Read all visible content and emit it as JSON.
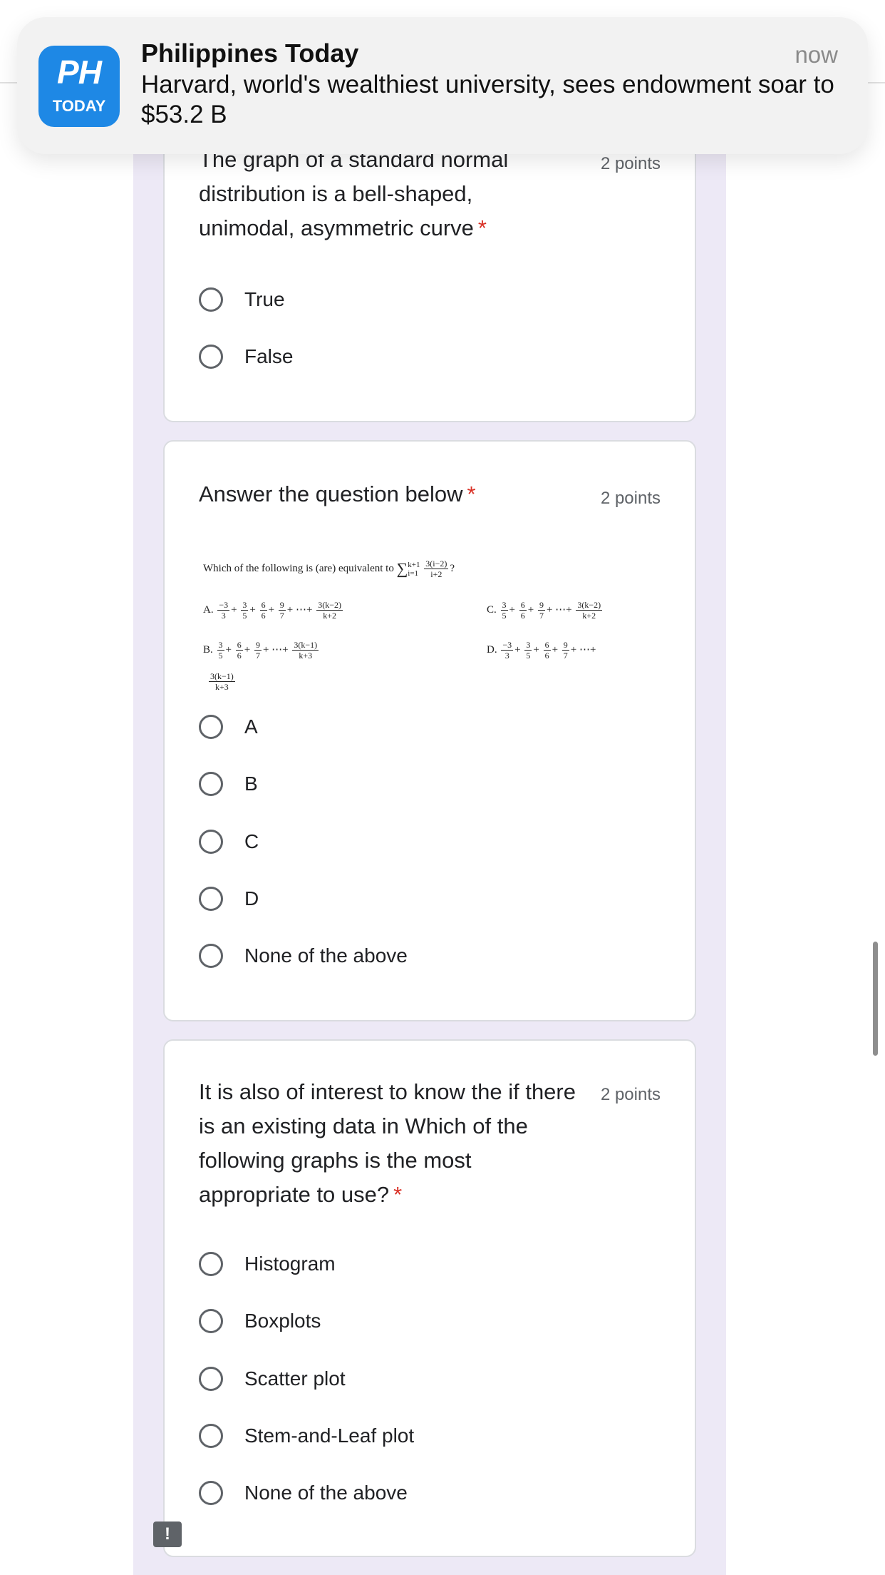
{
  "notification": {
    "app_icon_top": "PH",
    "app_icon_bottom": "TODAY",
    "app_name": "Philippines Today",
    "time": "now",
    "message": "Harvard, world's wealthiest university, sees endowment soar to $53.2 B"
  },
  "questions": [
    {
      "title": "The graph of a standard normal distribution is a bell-shaped, unimodal, asymmetric curve",
      "required_mark": "*",
      "points": "2 points",
      "options": [
        "True",
        "False"
      ]
    },
    {
      "title": "Answer the question below",
      "required_mark": "*",
      "points": "2 points",
      "image_text": {
        "stmt_prefix": "Which of the following is (are) equivalent to",
        "sum_upper": "k+1",
        "sum_lower": "i=1",
        "sum_num": "3(i−2)",
        "sum_den": "i+2",
        "qmark": "?",
        "a_label": "A.",
        "b_label": "B.",
        "c_label": "C.",
        "d_label": "D.",
        "n_m3": "−3",
        "n_3": "3",
        "n_6": "6",
        "n_9": "9",
        "d_3": "3",
        "d_5": "5",
        "d_6": "6",
        "d_7": "7",
        "plus": "+",
        "ellipsis": "⋯",
        "k_num_2": "3(k−2)",
        "k_den_2": "k+2",
        "k_num_1": "3(k−1)",
        "k_den_3": "k+3"
      },
      "options": [
        "A",
        "B",
        "C",
        "D",
        "None of the above"
      ]
    },
    {
      "title": "It is also of interest to know the if there is an existing data in Which of the following graphs is the most appropriate to use?",
      "required_mark": "*",
      "points": "2 points",
      "options": [
        "Histogram",
        "Boxplots",
        "Scatter plot",
        "Stem-and-Leaf plot",
        "None of the above"
      ]
    }
  ],
  "feedback_icon": "!",
  "colors": {
    "accent_bg": "#ede9f6",
    "required": "#d93025",
    "notification_icon": "#1e88e5"
  }
}
